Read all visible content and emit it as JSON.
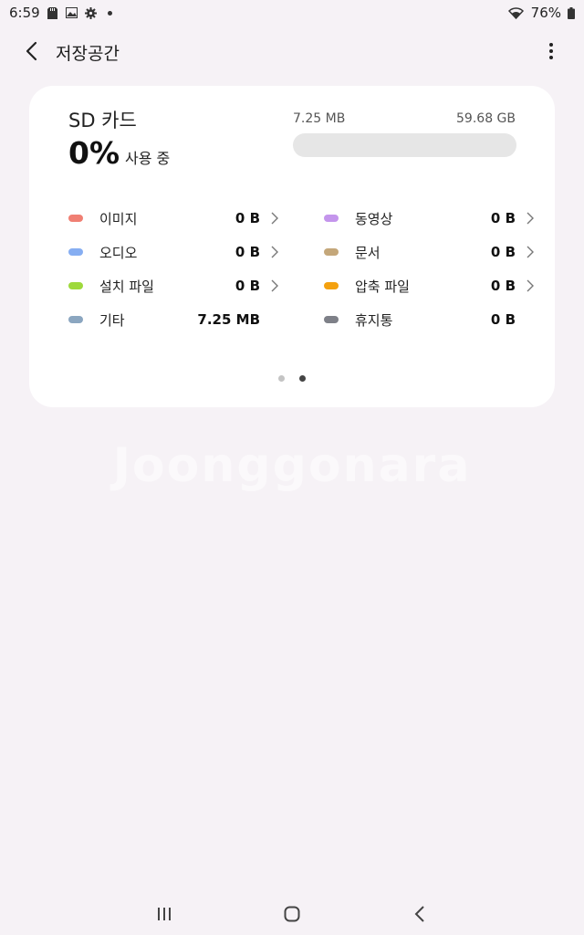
{
  "status_bar": {
    "time": "6:59",
    "battery": "76%",
    "left_icons": [
      "sd-card-icon",
      "gallery-icon",
      "settings-icon",
      "notification-dot"
    ],
    "right_icons": [
      "wifi-icon",
      "battery-icon"
    ]
  },
  "app_bar": {
    "title": "저장공간"
  },
  "storage": {
    "name": "SD 카드",
    "percent": "0%",
    "percent_label": "사용 중",
    "used": "7.25 MB",
    "total": "59.68 GB",
    "used_fraction": 0.0
  },
  "categories": [
    {
      "label": "이미지",
      "size": "0 B",
      "color": "#f07f73",
      "chevron": true
    },
    {
      "label": "동영상",
      "size": "0 B",
      "color": "#c495ec",
      "chevron": true
    },
    {
      "label": "오디오",
      "size": "0 B",
      "color": "#86aef2",
      "chevron": true
    },
    {
      "label": "문서",
      "size": "0 B",
      "color": "#c4a77a",
      "chevron": true
    },
    {
      "label": "설치 파일",
      "size": "0 B",
      "color": "#9ed93c",
      "chevron": true
    },
    {
      "label": "압축 파일",
      "size": "0 B",
      "color": "#f4a10f",
      "chevron": true
    },
    {
      "label": "기타",
      "size": "7.25 MB",
      "color": "#8ba6c0",
      "chevron": false
    },
    {
      "label": "휴지통",
      "size": "0 B",
      "color": "#7e8088",
      "chevron": false
    }
  ],
  "pager": {
    "count": 2,
    "active": 1
  },
  "watermark": "Joonggonara",
  "nav_bar": {
    "icons": [
      "recent-apps-icon",
      "home-icon",
      "back-icon"
    ]
  }
}
